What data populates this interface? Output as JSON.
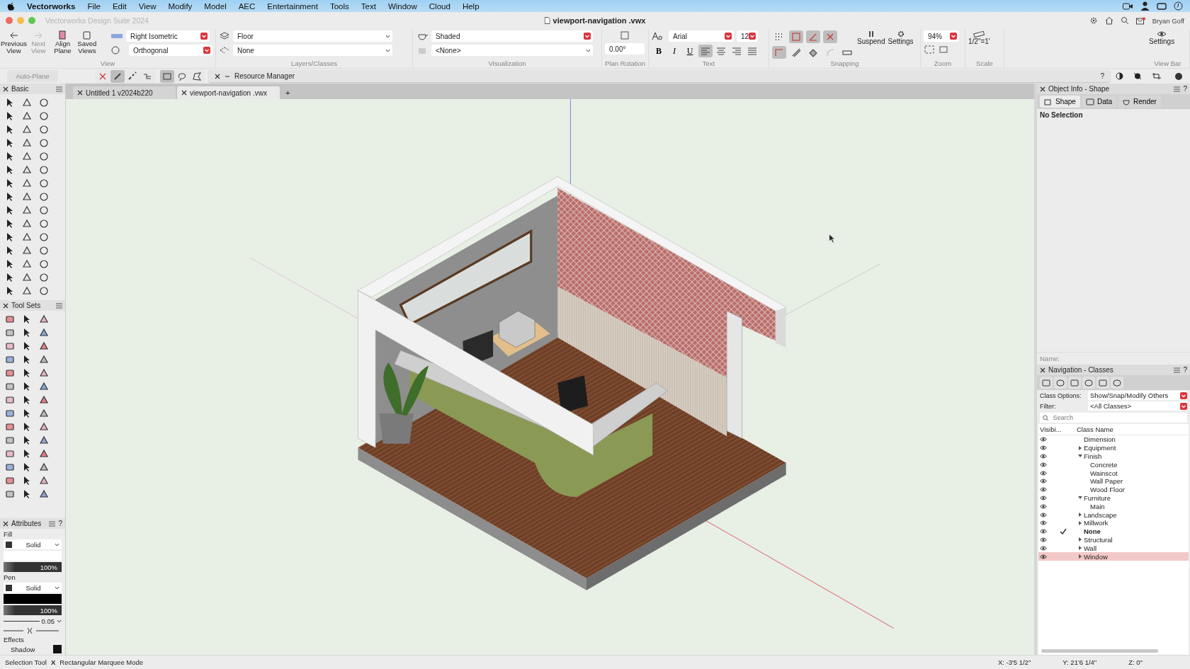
{
  "menubar": {
    "app": "Vectorworks",
    "items": [
      "File",
      "Edit",
      "View",
      "Modify",
      "Model",
      "AEC",
      "Entertainment",
      "Tools",
      "Text",
      "Window",
      "Cloud",
      "Help"
    ]
  },
  "window": {
    "title": "Vectorworks Design Suite 2024",
    "document": "viewport-navigation .vwx",
    "user": "Bryan Goff"
  },
  "toolbar": {
    "view": {
      "label": "View",
      "buttons": [
        {
          "label": "Previous View",
          "disabled": false
        },
        {
          "label": "Next View",
          "disabled": true
        },
        {
          "label": "Align Plane",
          "disabled": false
        },
        {
          "label": "Saved Views",
          "disabled": false
        }
      ],
      "projection": "Right Isometric",
      "rendering": "Orthogonal"
    },
    "layers_classes": {
      "label": "Layers/Classes",
      "layer": "Floor",
      "class": "None"
    },
    "visualization": {
      "label": "Visualization",
      "render_mode": "Shaded",
      "light": "<None>"
    },
    "plan_rotation": {
      "label": "Plan Rotation",
      "value": "0.00°"
    },
    "text": {
      "label": "Text",
      "font": "Arial",
      "size": "12",
      "styles": [
        "B",
        "I",
        "U"
      ],
      "alignments": [
        {
          "kind": "left",
          "selected": true
        },
        {
          "kind": "center",
          "selected": false
        },
        {
          "kind": "right",
          "selected": false
        },
        {
          "kind": "justify",
          "selected": false
        }
      ]
    },
    "snapping": {
      "label": "Snapping",
      "row_1": [
        {
          "kind": "grid",
          "selected": false
        },
        {
          "kind": "box",
          "selected": true
        },
        {
          "kind": "angle",
          "selected": true
        },
        {
          "kind": "cross",
          "selected": true
        }
      ],
      "row_2": [
        {
          "kind": "edge",
          "selected": true
        },
        {
          "kind": "tangent",
          "selected": false
        },
        {
          "kind": "fill",
          "selected": false
        },
        {
          "kind": "arc",
          "selected": false
        },
        {
          "kind": "wall",
          "selected": false
        }
      ],
      "suspend": "Suspend",
      "settings": "Settings"
    },
    "zoom": {
      "label": "Zoom",
      "value": "94%"
    },
    "scale": {
      "label": "Scale",
      "value": "1/2\"=1'"
    },
    "view_bar": {
      "label": "View Bar",
      "settings": "Settings"
    }
  },
  "mode_bar": {
    "auto_plane": {
      "label": "Auto-Plane",
      "disabled": true
    },
    "modes": [
      {
        "kind": "x",
        "selected": false
      },
      {
        "kind": "diagonal",
        "selected": true
      },
      {
        "kind": "dots",
        "selected": false
      },
      {
        "kind": "tree",
        "selected": false
      }
    ],
    "shapes": [
      {
        "kind": "rect",
        "selected": true
      },
      {
        "kind": "lasso",
        "selected": false
      },
      {
        "kind": "poly",
        "selected": false
      }
    ],
    "resource_manager": "Resource Manager",
    "help": "?"
  },
  "tabs": [
    {
      "label": "Untitled 1 v2024b220",
      "selected": false
    },
    {
      "label": "viewport-navigation .vwx",
      "selected": true
    }
  ],
  "new_tab": "+",
  "palettes": {
    "basic": "Basic",
    "tool_sets": "Tool Sets"
  },
  "attributes": {
    "title": "Attributes",
    "help": "?",
    "fill_label": "Fill",
    "fill_style": "Solid",
    "fill_opacity": "100%",
    "pen_label": "Pen",
    "pen_style": "Solid",
    "pen_opacity": "100%",
    "line_weight": "0.05",
    "effects_label": "Effects",
    "shadow_label": "Shadow"
  },
  "object_info": {
    "title": "Object Info - Shape",
    "help": "?",
    "tabs": [
      {
        "label": "Shape",
        "selected": true
      },
      {
        "label": "Data",
        "selected": false
      },
      {
        "label": "Render",
        "selected": false
      }
    ],
    "status": "No Selection",
    "name_label": "Name:"
  },
  "navigation": {
    "title": "Navigation - Classes",
    "help": "?",
    "class_options_label": "Class Options:",
    "class_options": "Show/Snap/Modify Others",
    "filter_label": "Filter:",
    "filter": "<All Classes>",
    "search": {
      "placeholder": "Search"
    },
    "columns": [
      "Visibi...",
      "Class Name"
    ],
    "classes": [
      {
        "name": "Dimension",
        "visible": true,
        "active": false,
        "selected": false
      },
      {
        "name": "Equipment",
        "visible": true,
        "active": false,
        "selected": false,
        "expanded": false
      },
      {
        "name": "Finish",
        "visible": true,
        "active": false,
        "selected": false,
        "expanded": true,
        "children": [
          {
            "name": "Concrete",
            "visible": true,
            "active": false,
            "selected": false
          },
          {
            "name": "Wainscot",
            "visible": true,
            "active": false,
            "selected": false
          },
          {
            "name": "Wall Paper",
            "visible": true,
            "active": false,
            "selected": false
          },
          {
            "name": "Wood Floor",
            "visible": true,
            "active": false,
            "selected": false
          }
        ]
      },
      {
        "name": "Furniture",
        "visible": true,
        "active": false,
        "selected": false,
        "expanded": true,
        "children": [
          {
            "name": "Main",
            "visible": true,
            "active": false,
            "selected": false
          }
        ]
      },
      {
        "name": "Landscape",
        "visible": true,
        "active": false,
        "selected": false,
        "expanded": false
      },
      {
        "name": "Millwork",
        "visible": true,
        "active": false,
        "selected": false,
        "expanded": false
      },
      {
        "name": "None",
        "visible": true,
        "active": true,
        "selected": false
      },
      {
        "name": "Structural",
        "visible": true,
        "active": false,
        "selected": false,
        "expanded": false
      },
      {
        "name": "Wall",
        "visible": true,
        "active": false,
        "selected": false,
        "expanded": false
      },
      {
        "name": "Window",
        "visible": true,
        "active": false,
        "selected": true,
        "expanded": false
      }
    ]
  },
  "status_bar": {
    "tool": "Selection Tool",
    "separator": "X",
    "mode": "Rectangular Marquee Mode",
    "x": "X: -3'5 1/2\"",
    "y": "Y: 21'6 1/4\"",
    "z": "Z: 0\""
  }
}
